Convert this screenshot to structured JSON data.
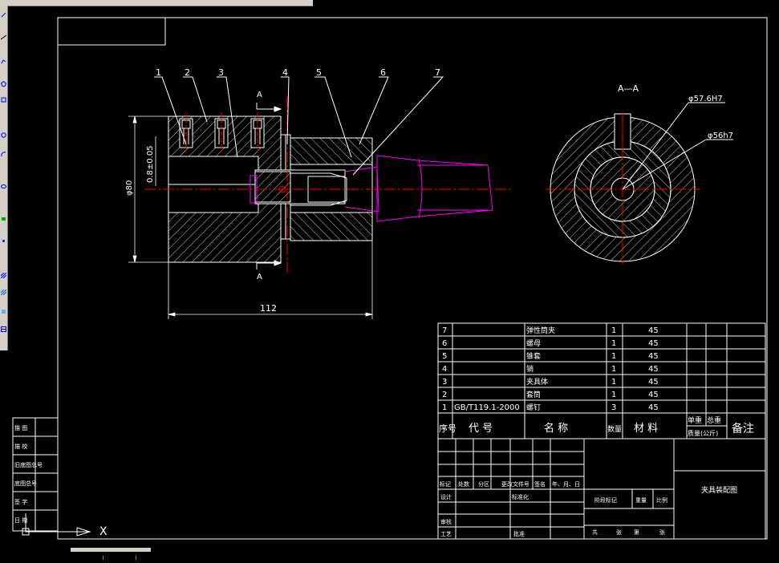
{
  "colors": {
    "background": "#000000",
    "line": "#ffffff",
    "centerline": "#ff0000",
    "part_magenta": "#ff00ff",
    "toolbar": "#d4d0c8"
  },
  "drawing": {
    "balloons": [
      "1",
      "2",
      "3",
      "4",
      "5",
      "6",
      "7"
    ],
    "section_marker_top": "A",
    "section_marker_bottom": "A",
    "section_view_title": "A—A",
    "dim_diameter": "φ80",
    "dim_tolerance": "0.8±0.05",
    "dim_length": "112",
    "dim_bore_1": "φ57.6H7",
    "dim_bore_2": "φ56h7"
  },
  "parts_list": {
    "rows": [
      {
        "no": "7",
        "code": "",
        "name": "弹性筒夹",
        "qty": "1",
        "material": "45"
      },
      {
        "no": "6",
        "code": "",
        "name": "螺母",
        "qty": "1",
        "material": "45"
      },
      {
        "no": "5",
        "code": "",
        "name": "锥套",
        "qty": "1",
        "material": "45"
      },
      {
        "no": "4",
        "code": "",
        "name": "销",
        "qty": "1",
        "material": "45"
      },
      {
        "no": "3",
        "code": "",
        "name": "夹具体",
        "qty": "1",
        "material": "45"
      },
      {
        "no": "2",
        "code": "",
        "name": "套筒",
        "qty": "1",
        "material": "45"
      },
      {
        "no": "1",
        "code": "GB/T119.1-2000",
        "name": "螺钉",
        "qty": "3",
        "material": "45"
      }
    ],
    "header": {
      "no": "序号",
      "code": "代 号",
      "name": "名 称",
      "qty": "数量",
      "material": "材 料",
      "single_weight": "单重",
      "total_weight": "总重",
      "weight_unit": "质量(公斤)",
      "remark": "备注"
    }
  },
  "title_block": {
    "title": "夹具装配图",
    "labels_row": [
      "标记",
      "处数",
      "分区",
      "更改文件号",
      "签名",
      "年、月、日"
    ],
    "design": "设计",
    "standardize": "标准化",
    "stage_mark": "阶段标记",
    "weight": "重量",
    "scale": "比例",
    "review": "审核",
    "process": "工艺",
    "approve": "批准",
    "sheet_text": [
      "共",
      "张",
      "第",
      "张"
    ]
  },
  "left_box": {
    "rows": [
      "描 图",
      "描 校",
      "旧底图总号",
      "底图总号",
      "签 字",
      "日 期"
    ]
  },
  "ucs": {
    "x_label": "X"
  }
}
